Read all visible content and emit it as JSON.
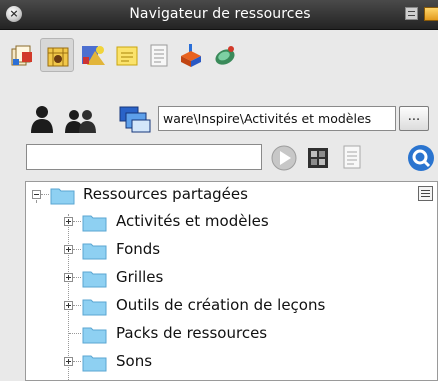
{
  "window": {
    "title": "Navigateur de ressources",
    "close_icon": "close-icon",
    "menu_icon": "window-menu-icon",
    "pin_icon": "pin-icon"
  },
  "tabs": [
    {
      "icon": "pages-tab-icon"
    },
    {
      "icon": "resources-tab-icon",
      "active": true
    },
    {
      "icon": "objects-tab-icon"
    },
    {
      "icon": "notes-tab-icon"
    },
    {
      "icon": "properties-tab-icon"
    },
    {
      "icon": "actions-tab-icon"
    },
    {
      "icon": "vote-tab-icon"
    }
  ],
  "source": {
    "my_resources_icon": "my-resources-icon",
    "shared_resources_icon": "shared-resources-icon",
    "online_resources_icon": "online-resources-icon",
    "path_value": "ware\\Inspire\\Activités et modèles",
    "browse_label": "..."
  },
  "search": {
    "value": "",
    "go_icon": "play-search-icon",
    "thumbnail_view_icon": "thumbnail-view-icon",
    "list_view_icon": "list-view-icon",
    "find_icon": "find-icon"
  },
  "tree": {
    "root": {
      "label": "Ressources partagées",
      "expanded": true
    },
    "items": [
      {
        "label": "Activités et modèles",
        "expandable": true
      },
      {
        "label": "Fonds",
        "expandable": true
      },
      {
        "label": "Grilles",
        "expandable": true
      },
      {
        "label": "Outils de création de leçons",
        "expandable": true
      },
      {
        "label": "Packs de ressources",
        "expandable": false
      },
      {
        "label": "Sons",
        "expandable": true
      }
    ],
    "panel_menu_icon": "panel-menu-icon"
  },
  "colors": {
    "titlebar": "#2f2f2f",
    "background": "#e9e9e9",
    "folder": "#8ed0f2",
    "go_button": "#c6c6c6"
  }
}
